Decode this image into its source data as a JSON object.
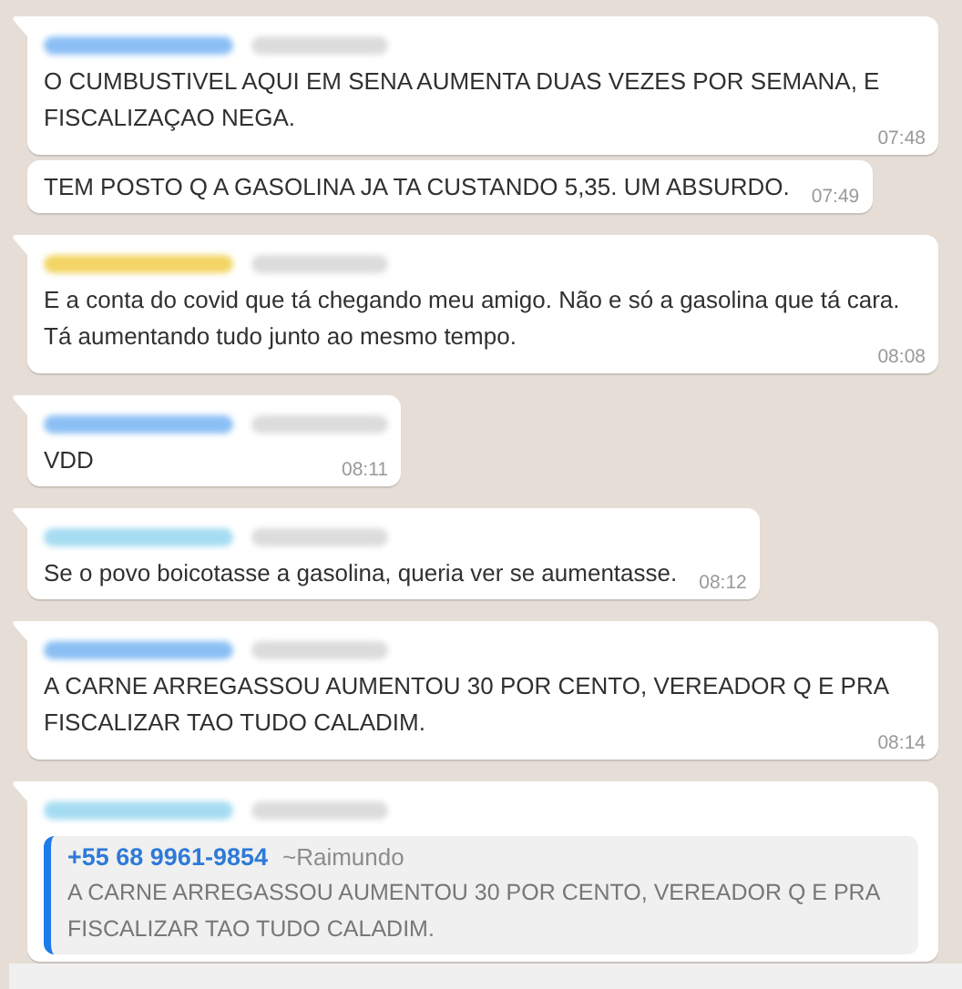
{
  "messages": [
    {
      "kind": "text",
      "tail": true,
      "color": "#8cc0f5",
      "text": "O CUMBUSTIVEL AQUI EM SENA AUMENTA DUAS VEZES POR SEMANA, E FISCALIZAÇAO NEGA.",
      "time": "07:48"
    },
    {
      "kind": "text",
      "tail": false,
      "text": "TEM POSTO Q A GASOLINA JA TA CUSTANDO 5,35. UM ABSURDO.",
      "time": "07:49"
    },
    {
      "kind": "text",
      "tail": true,
      "color": "#f3d566",
      "text": "E a conta do covid que tá chegando meu amigo. Não e só a gasolina que tá cara. Tá aumentando tudo junto ao mesmo tempo.",
      "time": "08:08"
    },
    {
      "kind": "text",
      "tail": true,
      "color": "#8cc0f5",
      "text": "VDD",
      "time": "08:11"
    },
    {
      "kind": "text",
      "tail": true,
      "color": "#a6dcf2",
      "text": "Se o povo boicotasse a gasolina, queria ver se aumentasse.",
      "time": "08:12"
    },
    {
      "kind": "text",
      "tail": true,
      "color": "#8cc0f5",
      "text": "A CARNE ARREGASSOU AUMENTOU 30 POR CENTO, VEREADOR Q E PRA FISCALIZAR TAO TUDO CALADIM.",
      "time": "08:14"
    },
    {
      "kind": "reply",
      "tail": true,
      "color": "#a6dcf2",
      "quote": {
        "phone": "+55 68 9961-9854",
        "name": "~Raimundo",
        "text": "A CARNE ARREGASSOU AUMENTOU 30 POR CENTO, VEREADOR Q E PRA FISCALIZAR TAO TUDO CALADIM."
      }
    }
  ]
}
